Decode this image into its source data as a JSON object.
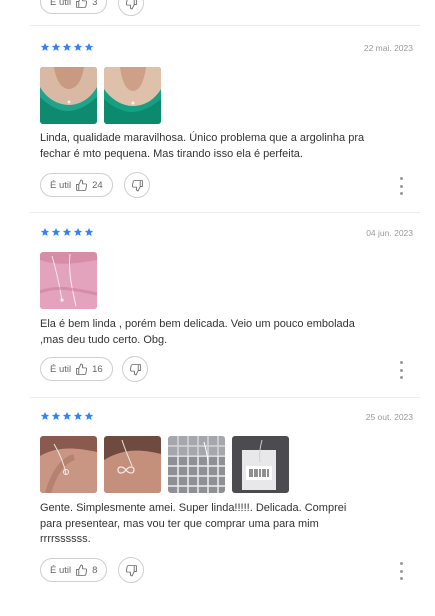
{
  "helpful_label": "É util",
  "top_partial": {
    "count": "3"
  },
  "reviews": [
    {
      "rating": 5,
      "date": "22 mai. 2023",
      "text_line1": "Linda, qualidade maravilhosa. Único problema que a argolinha pra",
      "text_line2": "fechar é mto pequena. Mas tirando isso ela é perfeita.",
      "text_line3": "",
      "helpful_count": "24"
    },
    {
      "rating": 5,
      "date": "04 jun. 2023",
      "text_line1": "Ela é bem linda , porém bem delicada. Veio um pouco embolada",
      "text_line2": ",mas deu tudo certo. Obg.",
      "text_line3": "",
      "helpful_count": "16"
    },
    {
      "rating": 5,
      "date": "25 out. 2023",
      "text_line1": "Gente. Simplesmente amei. Super linda!!!!!. Delicada. Comprei",
      "text_line2": "para presentear, mas vou ter que comprar uma para mim",
      "text_line3": "rrrrssssss.",
      "helpful_count": "8"
    }
  ],
  "colors": {
    "star": "#3483fa",
    "border": "#cfcfcf",
    "date": "#999999",
    "text": "#333333"
  },
  "icons": [
    "thumb-up-icon",
    "thumb-down-icon",
    "more-vertical-icon",
    "star-icon"
  ]
}
